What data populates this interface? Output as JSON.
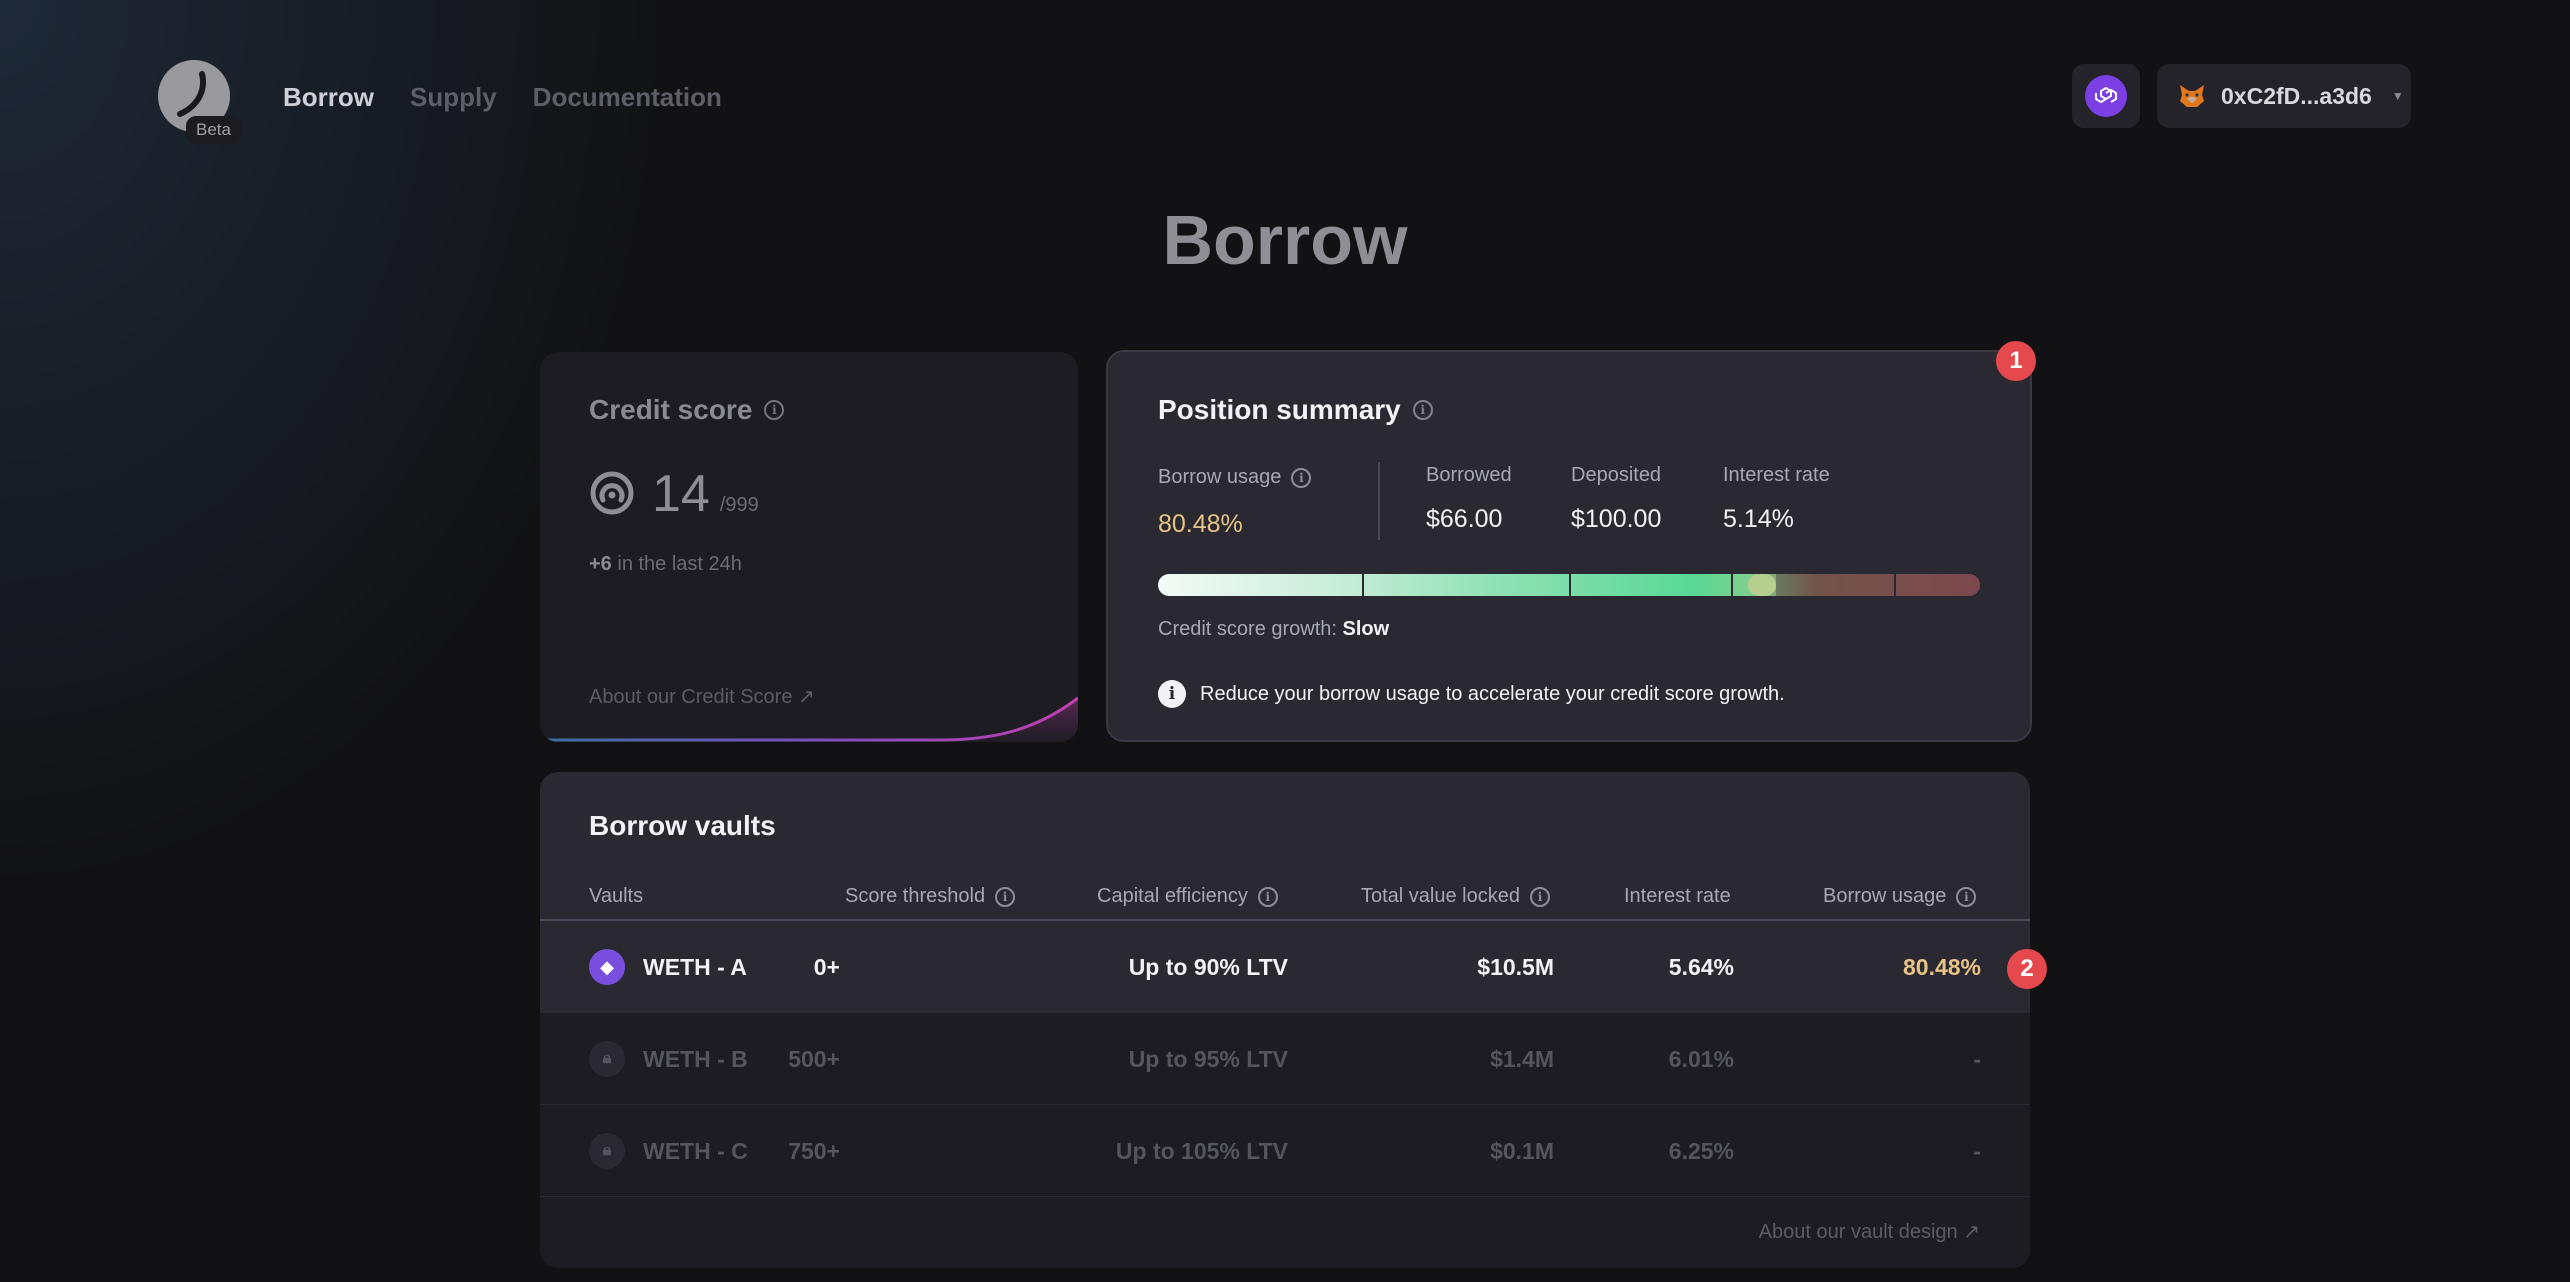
{
  "header": {
    "beta_label": "Beta",
    "nav": [
      {
        "label": "Borrow",
        "active": true
      },
      {
        "label": "Supply",
        "active": false
      },
      {
        "label": "Documentation",
        "active": false
      }
    ],
    "wallet_address": "0xC2fD...a3d6",
    "chain_icon": "polygon-icon",
    "wallet_icon": "metamask-fox-icon"
  },
  "page_title": "Borrow",
  "credit_score": {
    "title": "Credit score",
    "value": "14",
    "max": "/999",
    "delta_value": "+6",
    "delta_text": " in the last 24h",
    "link": "About our Credit Score ↗"
  },
  "position_summary": {
    "title": "Position summary",
    "borrow_usage_label": "Borrow usage",
    "borrow_usage_value": "80.48%",
    "borrow_usage_fraction": 0.8048,
    "stats": [
      {
        "label": "Borrowed",
        "value": "$66.00"
      },
      {
        "label": "Deposited",
        "value": "$100.00"
      },
      {
        "label": "Interest rate",
        "value": "5.14%"
      }
    ],
    "growth_label": "Credit score growth: ",
    "growth_value": "Slow",
    "tip": "Reduce your borrow usage to accelerate your credit score growth."
  },
  "badges": {
    "one": "1",
    "two": "2"
  },
  "vaults": {
    "title": "Borrow vaults",
    "columns": [
      "Vaults",
      "Score threshold",
      "Capital efficiency",
      "Total value locked",
      "Interest rate",
      "Borrow usage"
    ],
    "rows": [
      {
        "name": "WETH - A",
        "threshold": "0+",
        "efficiency": "Up to 90% LTV",
        "tvl": "$10.5M",
        "rate": "5.64%",
        "usage": "80.48%",
        "locked": false
      },
      {
        "name": "WETH - B",
        "threshold": "500+",
        "efficiency": "Up to 95% LTV",
        "tvl": "$1.4M",
        "rate": "6.01%",
        "usage": "-",
        "locked": true
      },
      {
        "name": "WETH - C",
        "threshold": "750+",
        "efficiency": "Up to 105% LTV",
        "tvl": "$0.1M",
        "rate": "6.25%",
        "usage": "-",
        "locked": true
      }
    ],
    "link": "About our vault design ↗"
  },
  "colors": {
    "accent_gold": "#e7c386",
    "badge_red": "#e5484d",
    "eth_purple": "#7a4fe0",
    "polygon_purple": "#7b3fe4"
  }
}
